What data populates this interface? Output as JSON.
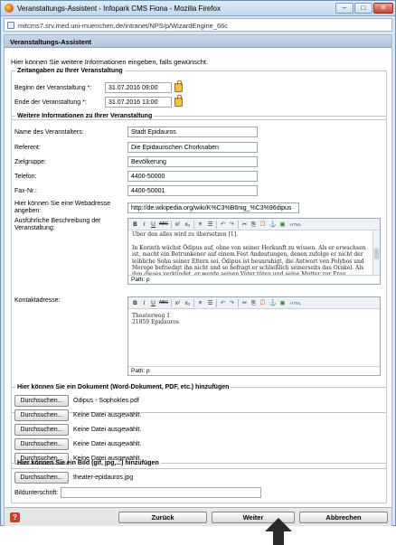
{
  "window": {
    "title": "Veranstaltungs-Assistent - Infopark CMS Fiona - Mozilla Firefox",
    "url": "mitcms7.srv.med.uni-muenchen.de/intranet/NPS/p/WizardEngine_66c",
    "buttons": [
      "–",
      "□",
      "✕"
    ]
  },
  "page": {
    "header": "Veranstaltungs-Assistent",
    "intro": "Hier können Sie weitere Informationen eingeben, falls gewünscht."
  },
  "time": {
    "legend": "Zeitangaben zu Ihrer Veranstaltung",
    "start_label": "Beginn der Veranstaltung *:",
    "start_value": "31.07.2016 09:00",
    "end_label": "Ende der Veranstaltung *:",
    "end_value": "31.07.2016 13:00"
  },
  "info": {
    "legend": "Weitere Informationen zu Ihrer Veranstaltung",
    "fields": [
      {
        "label": "Name des Veranstalters:",
        "value": "Stadt Epidauros"
      },
      {
        "label": "Referent:",
        "value": "Die Epidaurischen Chorknaben"
      },
      {
        "label": "Zielgruppe:",
        "value": "Bevölkerung"
      },
      {
        "label": "Telefon:",
        "value": "4400-50000"
      },
      {
        "label": "Fax-Nr.:",
        "value": "4400-50001"
      }
    ],
    "web_label": "Hier können Sie eine Webadresse angeben:",
    "web_value": "http://de.wikipedia.org/wiki/K%C3%B6nig_%C3%96dipus",
    "desc_label": "Ausführliche Beschreibung der Veranstaltung:",
    "desc_text": "Über den alles wird zu übersetzen [1].\n\nIn Korinth wächst Ödipus auf, ohne von seiner Herkunft zu wissen. Als er erwachsen ist, macht ein Betrunkener auf einem Fest Andeutungen, denen zufolge er nicht der leibliche Sohn seiner Eltern sei. Ödipus ist beunruhigt, die Antwort von Polybos und Merope befriedigt ihn nicht und so befragt er schließlich seinerseits das Orakel. Als ihm dieses verkündet, er werde seinen Vater töten und seine Mutter zur Frau nehmen, bricht er in die Ferne auf, um zu verhindern, dass sich die Prophezeiung an seinen vermeintlichen Eltern in Korinth erfüllt.",
    "contact_label": "Kontaktadresse:",
    "contact_line1": "Theaterweg 1",
    "contact_line2": "21059 Epidauros",
    "path_label": "Path: p",
    "toolbar": [
      "B",
      "I",
      "U",
      "ABC",
      "x²",
      "x₂",
      "≡",
      "☰",
      "↶",
      "↷",
      "✂",
      "⎘",
      "📋",
      "⚓",
      "▣",
      "HTML"
    ]
  },
  "documents": {
    "legend": "Hier können Sie ein Dokument (Word-Dokument, PDF, etc.) hinzufügen",
    "browse_label": "Durchsuchen...",
    "files": [
      "Ödipus - Sophokles.pdf",
      "Keine Datei ausgewählt.",
      "Keine Datei ausgewählt.",
      "Keine Datei ausgewählt.",
      "Keine Datei ausgewählt."
    ]
  },
  "image": {
    "legend": "Hier können Sie ein Bild (gif, jpg,...) hinzufügen",
    "browse_label": "Durchsuchen...",
    "file": "theater-epidauros.jpg",
    "caption_label": "Bildunterschrift:",
    "caption_value": ""
  },
  "footer": {
    "help": "?",
    "back": "Zurück",
    "next": "Weiter",
    "cancel": "Abbrechen"
  },
  "colors": {
    "titlebar": "#c4d6ec",
    "accent_arrow": "#2a2a2a"
  }
}
